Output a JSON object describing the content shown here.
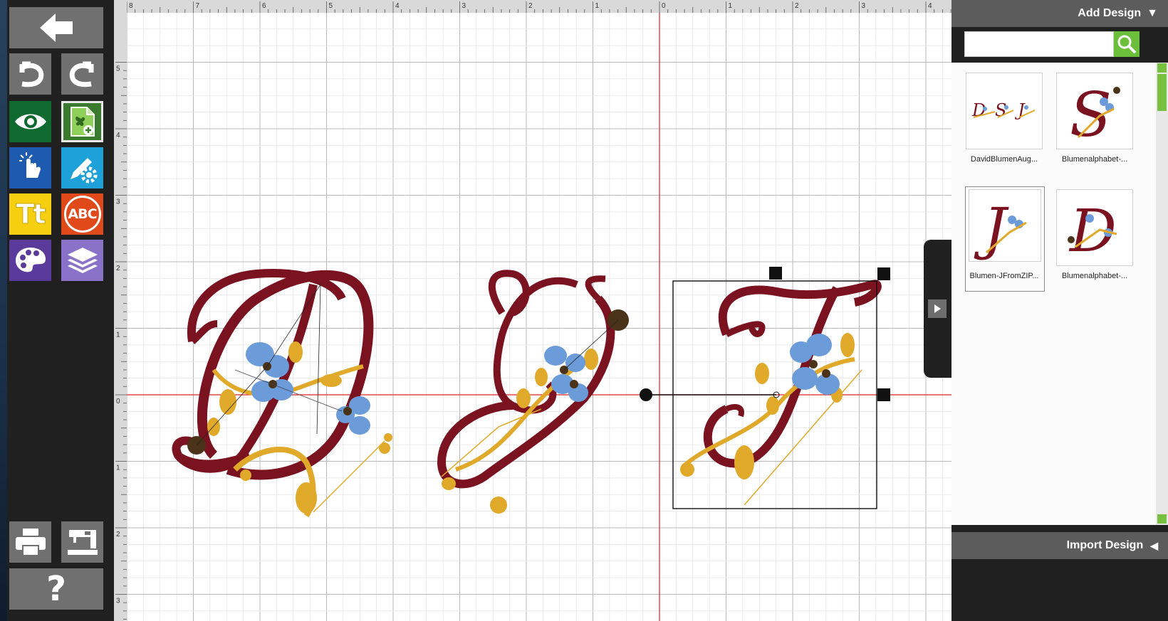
{
  "toolbar": {
    "help_label": "?",
    "text_tool_label": "Tt",
    "monogram_label": "ABC"
  },
  "ruler": {
    "top_labels": [
      "8",
      "7",
      "6",
      "5",
      "4",
      "3",
      "2",
      "1",
      "0",
      "1",
      "2",
      "3",
      "4"
    ],
    "left_labels": [
      "5",
      "4",
      "3",
      "2",
      "1",
      "0",
      "1",
      "2",
      "3"
    ]
  },
  "right_panel": {
    "add_design_label": "Add Design",
    "add_design_arrow": "▼",
    "search_placeholder": "",
    "import_design_label": "Import Design",
    "import_design_arrow": "◀",
    "designs": [
      {
        "name": "DavidBlumenAug...",
        "preview": "D S J"
      },
      {
        "name": "Blumenalphabet-...",
        "preview": "S"
      },
      {
        "name": "Blumen-JFromZIP...",
        "preview": "J"
      },
      {
        "name": "Blumenalphabet-...",
        "preview": "D"
      }
    ]
  },
  "canvas": {
    "letters": [
      "D",
      "S",
      "J"
    ]
  },
  "colors": {
    "thread_red": "#7a1220",
    "thread_gold": "#e0a92a",
    "thread_blue": "#6b9bd8",
    "thread_brown": "#4a3318",
    "accent_green": "#6bbf3a",
    "guide_red": "#e02020"
  }
}
